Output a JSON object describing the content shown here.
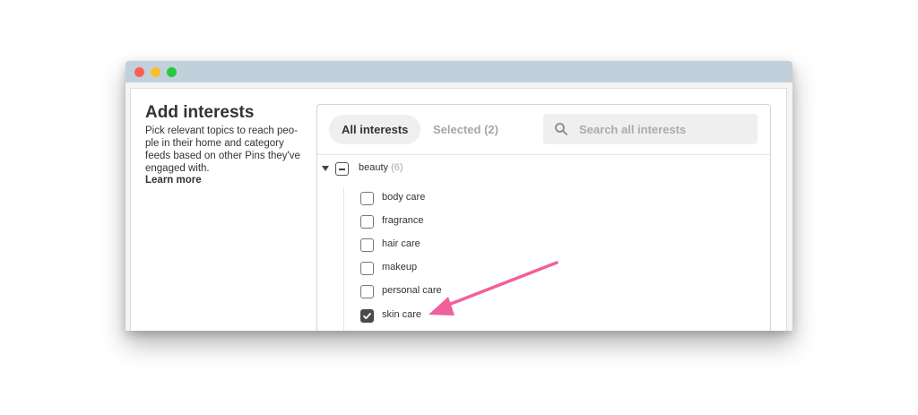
{
  "window": {
    "controls": [
      "close",
      "minimize",
      "maximize"
    ]
  },
  "sidebar": {
    "title": "Add interests",
    "description": "Pick relevant topics to reach peo-ple in their home and category feeds based on other Pins they've engaged with.",
    "learn_more": "Learn more"
  },
  "panel": {
    "tabs": [
      {
        "label": "All interests",
        "active": true
      },
      {
        "label": "Selected (2)",
        "active": false
      }
    ],
    "search": {
      "placeholder": "Search all interests",
      "value": ""
    },
    "category": {
      "label": "beauty",
      "count": "(6)",
      "expanded": true
    },
    "items": [
      {
        "label": "body care",
        "checked": false
      },
      {
        "label": "fragrance",
        "checked": false
      },
      {
        "label": "hair care",
        "checked": false
      },
      {
        "label": "makeup",
        "checked": false
      },
      {
        "label": "personal care",
        "checked": false
      },
      {
        "label": "skin care",
        "checked": true
      }
    ]
  },
  "colors": {
    "accent_arrow": "#f0609a",
    "titlebar": "#c2d0dc",
    "checked_box": "#4a4a4a"
  }
}
